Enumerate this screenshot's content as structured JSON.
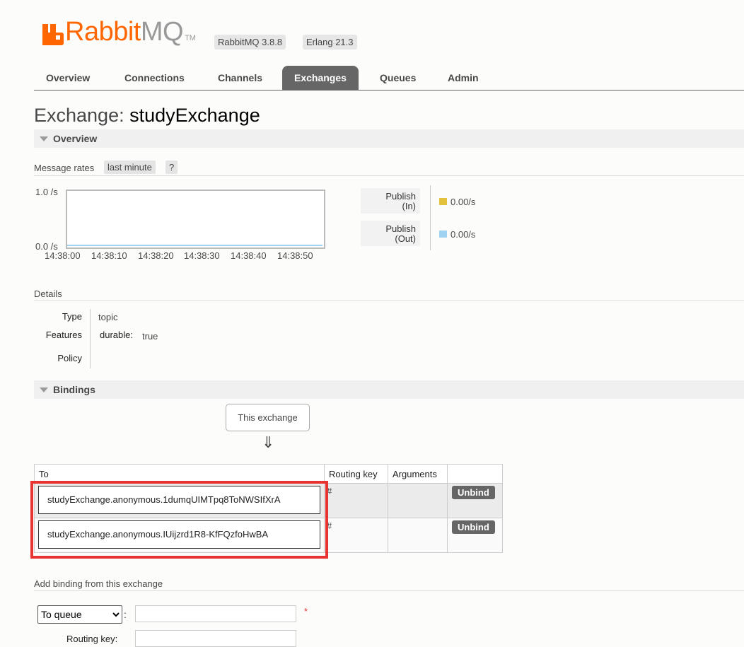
{
  "header": {
    "logo_rabbit": "Rabbit",
    "logo_mq": "MQ",
    "logo_tm": "TM",
    "version_badge": "RabbitMQ 3.8.8",
    "erlang_badge": "Erlang 21.3"
  },
  "nav": {
    "tabs": [
      {
        "label": "Overview"
      },
      {
        "label": "Connections"
      },
      {
        "label": "Channels"
      },
      {
        "label": "Exchanges",
        "active": true
      },
      {
        "label": "Queues"
      },
      {
        "label": "Admin"
      }
    ]
  },
  "page": {
    "title_prefix": "Exchange:",
    "title_name": "studyExchange"
  },
  "overview": {
    "section_label": "Overview",
    "message_rates_label": "Message rates",
    "range_button": "last minute",
    "help_button": "?",
    "y_top": "1.0 /s",
    "y_bottom": "0.0 /s",
    "x_ticks": [
      "14:38:00",
      "14:38:10",
      "14:38:20",
      "14:38:30",
      "14:38:40",
      "14:38:50"
    ],
    "legend": [
      {
        "line1": "Publish",
        "line2": "(In)",
        "value": "0.00/s",
        "color": "#e4c13c"
      },
      {
        "line1": "Publish",
        "line2": "(Out)",
        "value": "0.00/s",
        "color": "#9fd1f1"
      }
    ]
  },
  "details": {
    "label": "Details",
    "type_key": "Type",
    "type_value": "topic",
    "features_key": "Features",
    "features_sub_key": "durable:",
    "features_value": "true",
    "policy_key": "Policy"
  },
  "bindings": {
    "section_label": "Bindings",
    "this_exchange": "This exchange",
    "arrow": "⇓",
    "columns": {
      "to": "To",
      "routing_key": "Routing key",
      "arguments": "Arguments"
    },
    "rows": [
      {
        "to": "studyExchange.anonymous.1dumqUIMTpq8ToNWSIfXrA",
        "routing_key": "#",
        "arguments": "",
        "action": "Unbind"
      },
      {
        "to": "studyExchange.anonymous.IUijzrd1R8-KfFQzfoHwBA",
        "routing_key": "#",
        "arguments": "",
        "action": "Unbind"
      }
    ]
  },
  "add_binding": {
    "label": "Add binding from this exchange",
    "destination_type": "To queue",
    "colon": ":",
    "required_mark": "*",
    "routing_key_label": "Routing key:"
  }
}
